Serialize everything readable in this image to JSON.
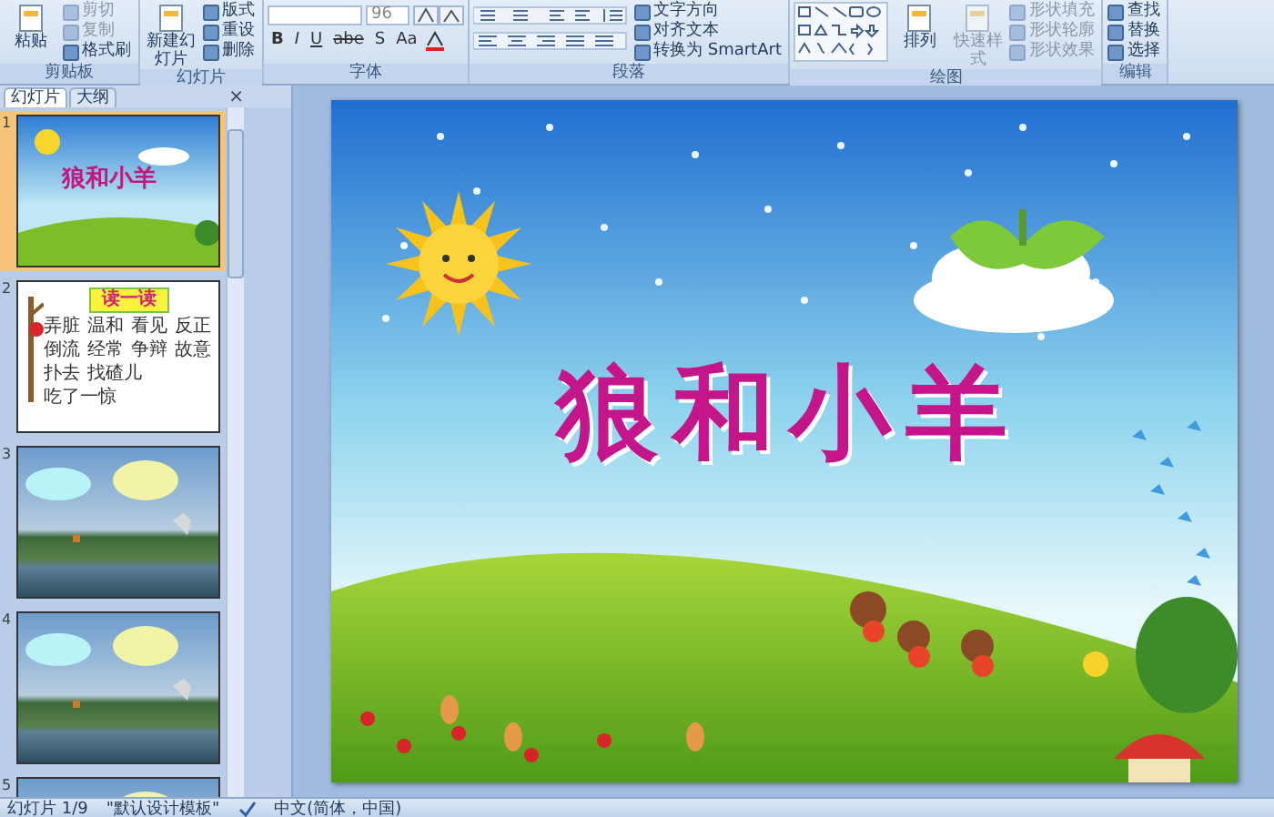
{
  "ribbon": {
    "groups": [
      {
        "kind": "clipboard",
        "label": "剪贴板",
        "large": [
          {
            "label": "粘贴",
            "disabled": false
          }
        ],
        "small": [
          {
            "label": "剪切",
            "disabled": true
          },
          {
            "label": "复制",
            "disabled": true
          },
          {
            "label": "格式刷",
            "disabled": false
          }
        ]
      },
      {
        "kind": "slides",
        "label": "幻灯片",
        "large": [
          {
            "label": "新建幻灯片",
            "disabled": false
          }
        ],
        "small": [
          {
            "label": "版式",
            "disabled": false
          },
          {
            "label": "重设",
            "disabled": false
          },
          {
            "label": "删除",
            "disabled": false
          }
        ]
      },
      {
        "kind": "font",
        "label": "字体",
        "font_size": "96",
        "format_buttons": [
          "B",
          "I",
          "U",
          "abe",
          "S",
          "Aa"
        ]
      },
      {
        "kind": "paragraph",
        "label": "段落",
        "small": [
          {
            "label": "文字方向",
            "disabled": false
          },
          {
            "label": "对齐文本",
            "disabled": false
          },
          {
            "label": "转换为 SmartArt",
            "disabled": false
          }
        ]
      },
      {
        "kind": "drawing",
        "label": "绘图",
        "large": [
          {
            "label": "排列",
            "disabled": false
          },
          {
            "label": "快速样式",
            "disabled": true
          }
        ],
        "small": [
          {
            "label": "形状填充",
            "disabled": true
          },
          {
            "label": "形状轮廓",
            "disabled": true
          },
          {
            "label": "形状效果",
            "disabled": true
          }
        ]
      },
      {
        "kind": "editing",
        "label": "编辑",
        "small": [
          {
            "label": "查找",
            "disabled": false
          },
          {
            "label": "替换",
            "disabled": false
          },
          {
            "label": "选择",
            "disabled": false
          }
        ]
      }
    ]
  },
  "panel": {
    "tabs": [
      {
        "label": "幻灯片",
        "selected": true
      },
      {
        "label": "大纲",
        "selected": false
      }
    ],
    "close": "×",
    "slides": [
      {
        "number": "1",
        "kind": "title",
        "selected": true,
        "title": "狼和小羊"
      },
      {
        "number": "2",
        "kind": "reading",
        "selected": false,
        "title": "读一读",
        "words": [
          "弄脏",
          "温和",
          "看见",
          "反正",
          "倒流",
          "经常",
          "争辩",
          "故意",
          "扑去",
          "找碴儿",
          "吃了一惊"
        ]
      },
      {
        "number": "3",
        "kind": "scene",
        "selected": false
      },
      {
        "number": "4",
        "kind": "scene",
        "selected": false
      },
      {
        "number": "5",
        "kind": "scene",
        "selected": false
      }
    ]
  },
  "slide": {
    "title": "狼和小羊"
  },
  "status_bar": [
    "幻灯片 1/9",
    "\"默认设计模板\"",
    "中文(简体，中国)"
  ]
}
